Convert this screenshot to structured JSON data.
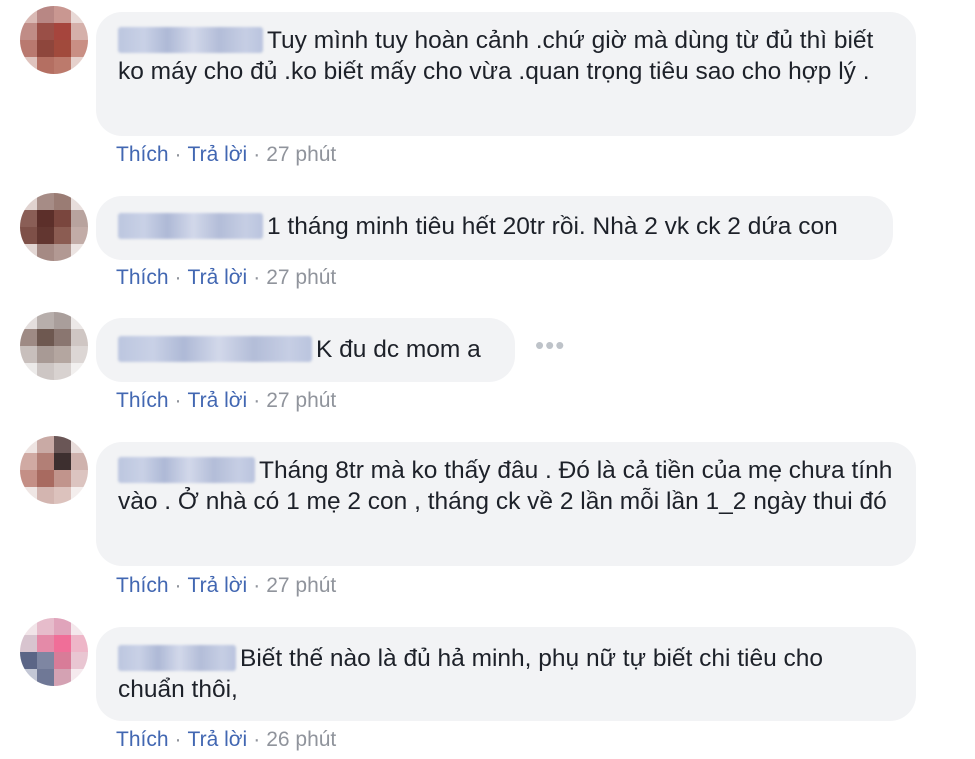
{
  "comments": [
    {
      "text": "Tuy mình tuy hoàn cảnh .chứ giờ mà dùng từ đủ thì biết ko máy cho đủ .ko biết mấy cho vừa .quan trọng tiêu sao cho hợp lý .",
      "like": "Thích",
      "reply": "Trả lời",
      "time": "27 phút"
    },
    {
      "text": "1 tháng minh tiêu hết 20tr rồi. Nhà 2 vk ck 2 dứa con",
      "like": "Thích",
      "reply": "Trả lời",
      "time": "27 phút"
    },
    {
      "text": "K đu dc mom a",
      "like": "Thích",
      "reply": "Trả lời",
      "time": "27 phút"
    },
    {
      "text": "Tháng 8tr mà ko thấy đâu . Đó là cả tiền của mẹ chưa tính vào . Ở nhà có 1 mẹ 2 con , tháng ck về 2 lần mỗi lần 1_2 ngày thui đó",
      "like": "Thích",
      "reply": "Trả lời",
      "time": "27 phút"
    },
    {
      "text": "Biết thế nào là đủ hả minh, phụ nữ tự biết chi tiêu cho chuẩn thôi,",
      "like": "Thích",
      "reply": "Trả lời",
      "time": "26 phút"
    }
  ],
  "more_icon": "horizontal-ellipsis-icon",
  "colors": {
    "link": "#4267b2",
    "meta": "#90949c",
    "bubble": "#f2f3f5"
  }
}
